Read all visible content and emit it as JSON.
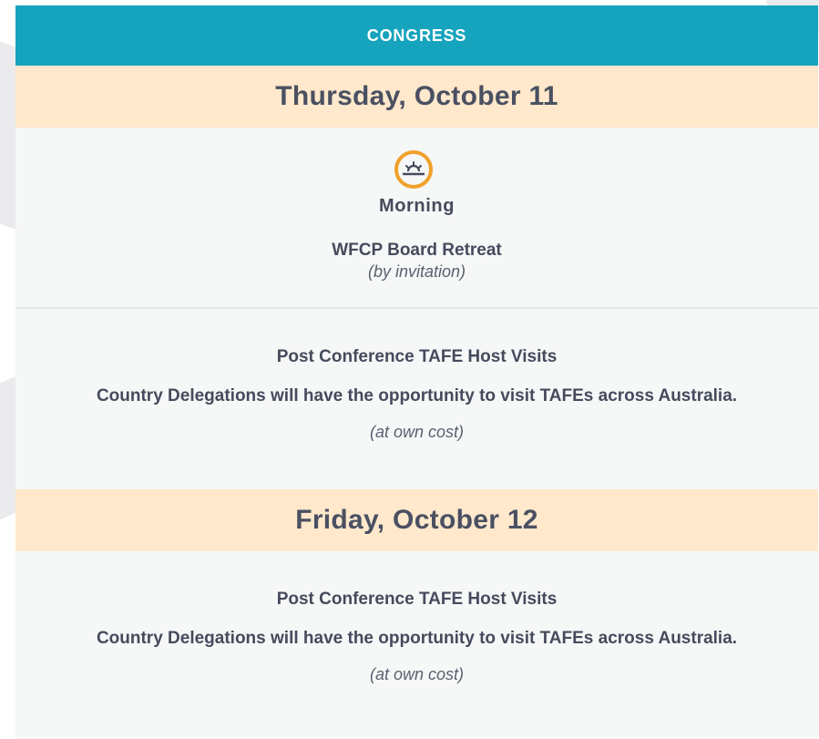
{
  "header": {
    "title": "CONGRESS"
  },
  "days": [
    {
      "title": "Thursday, October 11",
      "sessions": [
        {
          "icon": "sunrise-icon",
          "period": "Morning",
          "title": "WFCP Board Retreat",
          "note": "(by invitation)"
        },
        {
          "title": "Post Conference TAFE Host Visits",
          "description": "Country Delegations will have the opportunity to visit TAFEs across Australia.",
          "note": "(at own cost)"
        }
      ]
    },
    {
      "title": "Friday, October 12",
      "sessions": [
        {
          "title": "Post Conference TAFE Host Visits",
          "description": "Country Delegations will have the opportunity to visit TAFEs across Australia.",
          "note": "(at own cost)"
        }
      ]
    }
  ],
  "colors": {
    "header_bg": "#16a3bd",
    "day_bg": "#ffe8cb",
    "panel_bg": "#f6f7f7",
    "text": "#454b5c",
    "icon_ring": "#f0a12a"
  }
}
